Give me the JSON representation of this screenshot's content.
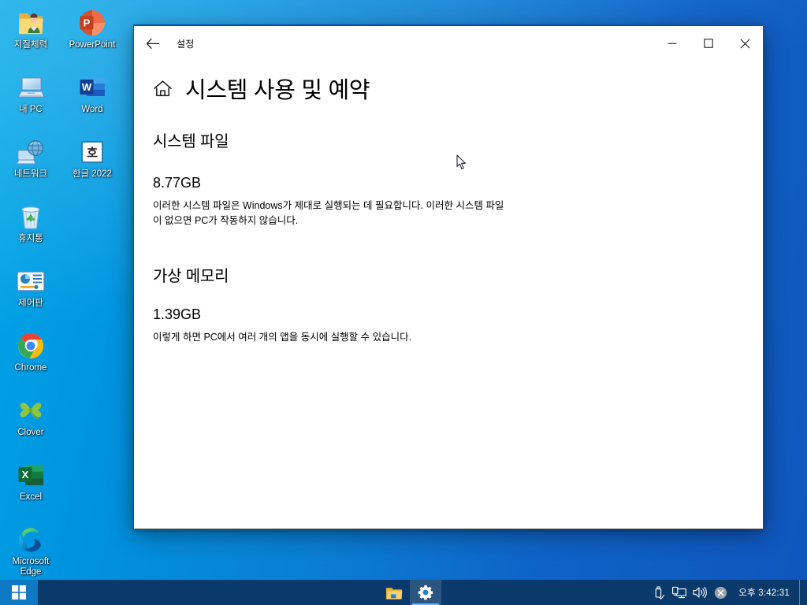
{
  "desktop": {
    "icons": [
      {
        "label": "저질체력",
        "icon": "user-folder-icon"
      },
      {
        "label": "PowerPoint",
        "icon": "powerpoint-icon"
      },
      {
        "label": "내 PC",
        "icon": "this-pc-icon"
      },
      {
        "label": "Word",
        "icon": "word-icon"
      },
      {
        "label": "네트워크",
        "icon": "network-icon"
      },
      {
        "label": "한글 2022",
        "icon": "hangul-icon"
      },
      {
        "label": "휴지통",
        "icon": "recycle-bin-icon"
      },
      {
        "label": "제어판",
        "icon": "control-panel-icon"
      },
      {
        "label": "Chrome",
        "icon": "chrome-icon"
      },
      {
        "label": "Clover",
        "icon": "clover-icon"
      },
      {
        "label": "Excel",
        "icon": "excel-icon"
      },
      {
        "label": "Microsoft Edge",
        "icon": "edge-icon"
      }
    ]
  },
  "window": {
    "app_title": "설정",
    "back_icon": "back-arrow-icon",
    "minimize_label": "─",
    "maximize_label": "□",
    "close_label": "✕"
  },
  "page": {
    "home_icon": "home-icon",
    "title": "시스템 사용 및 예약",
    "sections": [
      {
        "heading": "시스템 파일",
        "value": "8.77GB",
        "description": "이러한 시스템 파일은 Windows가 제대로 실행되는 데 필요합니다. 이러한 시스템 파일이 없으면 PC가 작동하지 않습니다."
      },
      {
        "heading": "가상 메모리",
        "value": "1.39GB",
        "description": "이렇게 하면 PC에서 여러 개의 앱을 동시에 실행할 수 있습니다."
      }
    ]
  },
  "taskbar": {
    "start_icon": "windows-logo-icon",
    "buttons": [
      {
        "name": "file-explorer",
        "icon": "file-explorer-icon",
        "active": false
      },
      {
        "name": "settings",
        "icon": "gear-icon",
        "active": true
      }
    ],
    "tray": [
      {
        "name": "safely-remove-hardware",
        "icon": "usb-eject-icon"
      },
      {
        "name": "network",
        "icon": "network-monitor-icon"
      },
      {
        "name": "volume",
        "icon": "speaker-icon"
      },
      {
        "name": "action-center-error",
        "icon": "circle-x-icon"
      }
    ],
    "clock": "오후 3:42:31"
  },
  "colors": {
    "desktop_start": "#00a8e8",
    "desktop_end": "#0f56bd",
    "taskbar": "#0a3a6b",
    "start_hover": "#1079c4",
    "accent": "#0a64c8",
    "window_bg": "#ffffff"
  }
}
